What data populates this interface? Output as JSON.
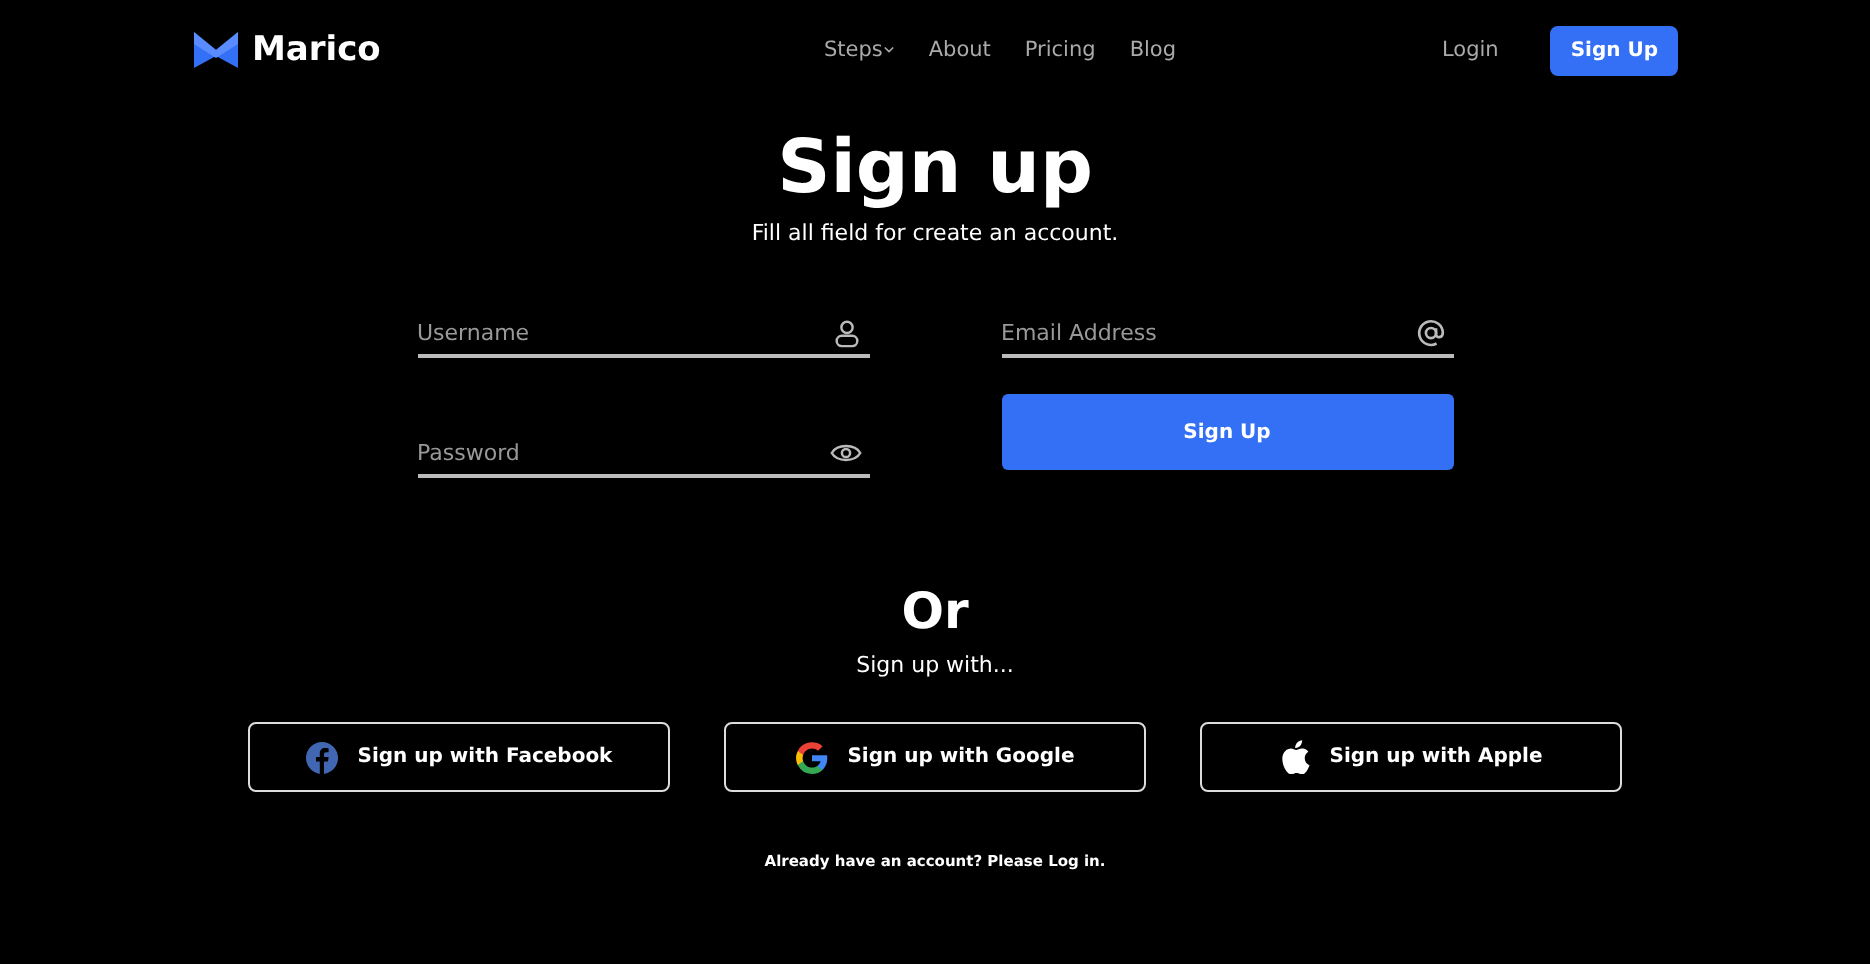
{
  "brand": {
    "name": "Marico"
  },
  "nav": {
    "links": [
      {
        "label": "Steps",
        "has_dropdown": true
      },
      {
        "label": "About",
        "has_dropdown": false
      },
      {
        "label": "Pricing",
        "has_dropdown": false
      },
      {
        "label": "Blog",
        "has_dropdown": false
      }
    ],
    "login": "Login",
    "signup": "Sign Up"
  },
  "heading": "Sign up",
  "subheading": "Fill all field for create an account.",
  "form": {
    "fields": [
      {
        "placeholder": "Username",
        "kind": "user"
      },
      {
        "placeholder": "Email Address",
        "kind": "email"
      },
      {
        "placeholder": "Password",
        "kind": "password"
      }
    ],
    "submit": "Sign Up"
  },
  "or": "Or",
  "alt_heading": "Sign up with...",
  "social": [
    {
      "label": "Sign up with Facebook",
      "kind": "facebook"
    },
    {
      "label": "Sign up with Google",
      "kind": "google"
    },
    {
      "label": "Sign up with Apple",
      "kind": "apple"
    }
  ],
  "footer": "Already have an account? Please Log in."
}
